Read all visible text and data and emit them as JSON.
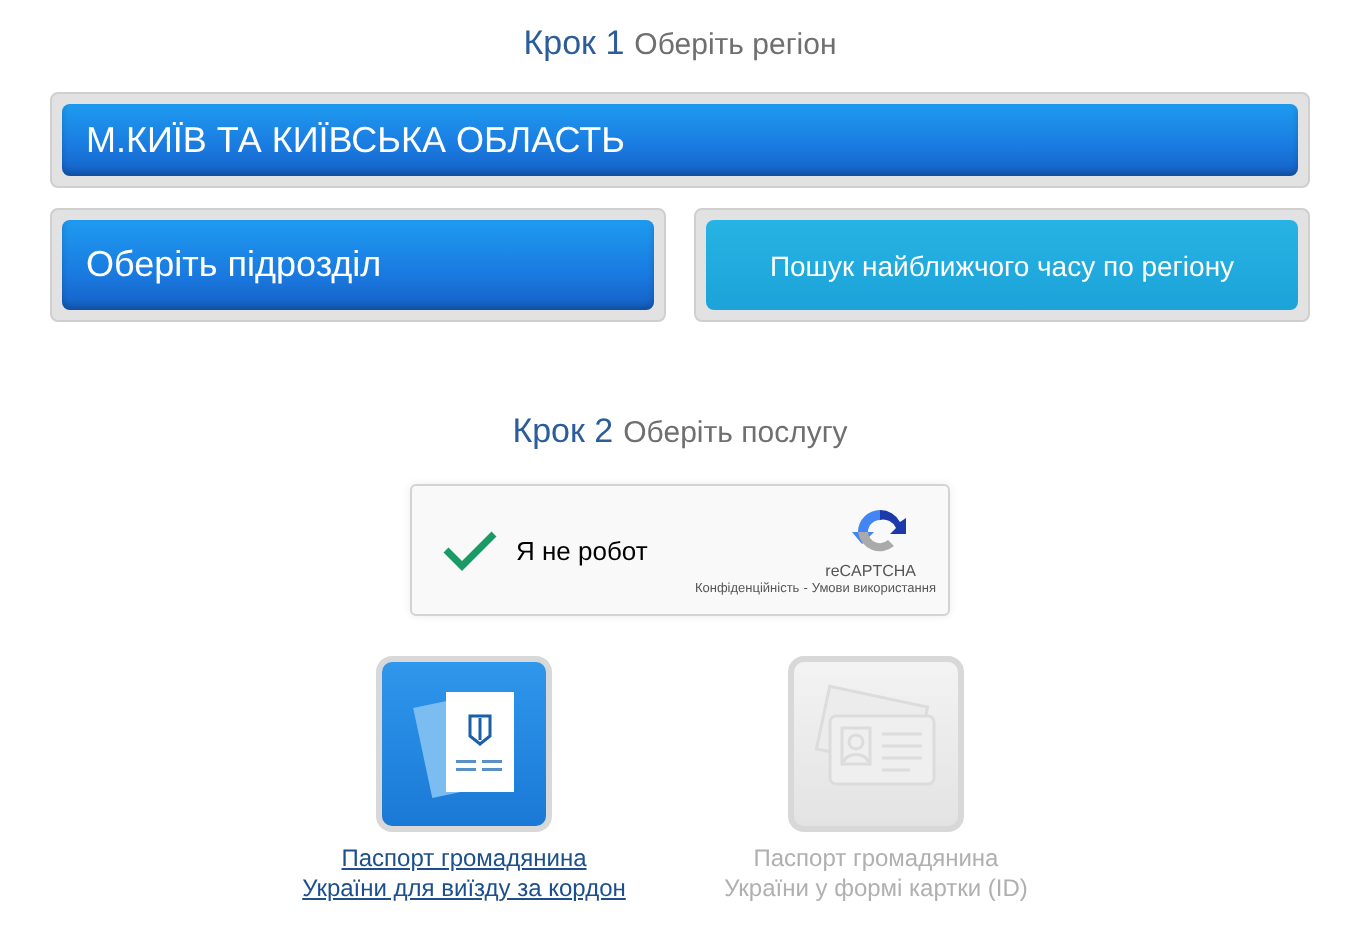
{
  "step1": {
    "number": "Крок 1",
    "title": "Оберіть регіон"
  },
  "region_select": {
    "value": "М.КИЇВ ТА КИЇВСЬКА ОБЛАСТЬ"
  },
  "subdivision_select": {
    "value": "Оберіть підрозділ"
  },
  "nearest_time_button": {
    "label": "Пошук найближчого часу по регіону"
  },
  "step2": {
    "number": "Крок 2",
    "title": "Оберіть послугу"
  },
  "captcha": {
    "label": "Я не робот",
    "checked": true,
    "brand": "reCAPTCHA",
    "privacy": "Конфіденційність",
    "separator": "-",
    "terms": "Умови використання"
  },
  "services": [
    {
      "kind": "passport",
      "line1": "Паспорт громадянина",
      "line2": "України для виїзду за кордон",
      "disabled": false
    },
    {
      "kind": "id_card",
      "line1": "Паспорт громадянина",
      "line2": "України у формі картки (ID)",
      "disabled": true
    }
  ]
}
